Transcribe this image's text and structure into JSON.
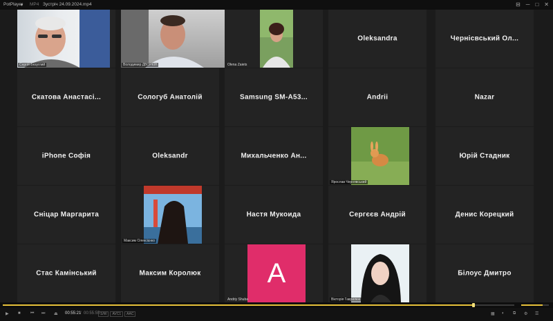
{
  "titlebar": {
    "app": "PotPlayer",
    "mode": "MP4",
    "file": "Зустріч 24.09.2024.mp4",
    "pin": "⊟",
    "minimize": "─",
    "maximize": "□",
    "close": "✕"
  },
  "participants": {
    "row1": {
      "v1": "Сергій Безуглий",
      "v2": "Володимир ДВОРКІН",
      "v3": "Olena Zaiets",
      "n4": "Oleksandra",
      "n5": "Чернiсвський Ол..."
    },
    "row2": {
      "n1": "Скатова Анастасі...",
      "n2": "Сологуб Анатолій",
      "n3": "Samsung SM-A53...",
      "n4": "Andrii",
      "n5": "Nazar"
    },
    "row3": {
      "n1": "iPhone Софія",
      "n2": "Oleksandr",
      "n3": "Михальченко Ан...",
      "v4": "Ярослав Чернявський",
      "n5": "Юрій Стадник"
    },
    "row4": {
      "n1": "Сніцар Маргарита",
      "v2": "Максим Олексієнко",
      "n3": "Настя Мукоида",
      "n4": "Сергєєв Андрій",
      "n5": "Денис Корецкий"
    },
    "row5": {
      "n1": "Стас Камiнський",
      "n2": "Максим Королюк",
      "avatar_letter": "A",
      "v3": "Andriy Shuba",
      "v4": "Вікторія Гаврилюк",
      "n5": "Білоус Дмитро"
    }
  },
  "colors": {
    "tile_bg": "#232323",
    "avatar_bg": "#e02d6a",
    "accent": "#e8c23a"
  },
  "playback": {
    "progress": 0.92,
    "volume": 0.78,
    "current_time": "00:55:21",
    "total_time": "00:55:55",
    "format_chips": [
      "S/W",
      "AVC1",
      "AAC"
    ]
  },
  "controls": {
    "play": "▶",
    "stop": "■",
    "prev": "⏮",
    "next": "⏭",
    "eject": "⏏",
    "right_icons": [
      "▦",
      "◐",
      "⧉",
      "⚙",
      "☰"
    ]
  }
}
